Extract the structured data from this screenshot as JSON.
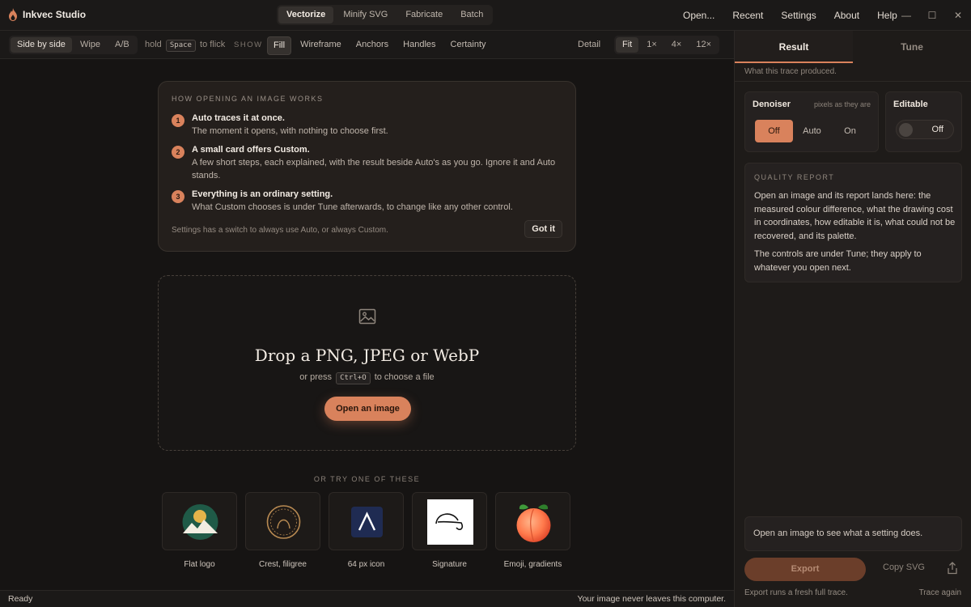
{
  "app": {
    "name": "Inkvec Studio"
  },
  "modes": [
    "Vectorize",
    "Minify SVG",
    "Fabricate",
    "Batch"
  ],
  "menu": [
    "Open...",
    "Recent",
    "Settings",
    "About",
    "Help"
  ],
  "window_controls": {
    "minimize": "—",
    "maximize": "☐",
    "close": "✕"
  },
  "toolbar": {
    "compare": [
      "Side by side",
      "Wipe",
      "A/B"
    ],
    "hold": "hold",
    "space_key": "Space",
    "to_flick": "to flick",
    "show_label": "SHOW",
    "show_items": [
      "Fill",
      "Wireframe",
      "Anchors",
      "Handles",
      "Certainty"
    ],
    "detail": "Detail",
    "zoom": [
      "Fit",
      "1×",
      "4×",
      "12×"
    ]
  },
  "how": {
    "title": "HOW OPENING AN IMAGE WORKS",
    "steps": [
      {
        "num": "1",
        "heading": "Auto traces it at once.",
        "desc": "The moment it opens, with nothing to choose first."
      },
      {
        "num": "2",
        "heading": "A small card offers Custom.",
        "desc": "A few short steps, each explained, with the result beside Auto's as you go. Ignore it and Auto stands."
      },
      {
        "num": "3",
        "heading": "Everything is an ordinary setting.",
        "desc": "What Custom chooses is under Tune afterwards, to change like any other control."
      }
    ],
    "footer": "Settings has a switch to always use Auto, or always Custom.",
    "got_it": "Got it"
  },
  "drop": {
    "title": "Drop a PNG, JPEG or WebP",
    "sub_before": "or press",
    "shortcut": "Ctrl+O",
    "sub_after": "to choose a file",
    "button": "Open an image"
  },
  "samples": {
    "label": "OR TRY ONE OF THESE",
    "items": [
      "Flat logo",
      "Crest, filigree",
      "64 px icon",
      "Signature",
      "Emoji, gradients"
    ]
  },
  "status": {
    "left": "Ready",
    "right": "Your image never leaves this computer."
  },
  "panel": {
    "tabs": [
      "Result",
      "Tune"
    ],
    "subtitle": "What this trace produced.",
    "denoiser": {
      "title": "Denoiser",
      "note": "pixels as they are",
      "options": [
        "Off",
        "Auto",
        "On"
      ],
      "selected": "Off"
    },
    "editable": {
      "title": "Editable",
      "state": "Off"
    },
    "quality": {
      "title": "QUALITY REPORT",
      "p1": "Open an image and its report lands here: the measured colour difference, what the drawing cost in coordinates, how editable it is, what could not be recovered, and its palette.",
      "p2": "The controls are under Tune; they apply to whatever you open next."
    },
    "hint": "Open an image to see what a setting does.",
    "export": "Export",
    "copy_svg": "Copy SVG",
    "foot_left": "Export runs a fresh full trace.",
    "foot_right": "Trace again"
  },
  "colors": {
    "accent": "#d9825c",
    "background": "#161413",
    "panel": "#1e1b19"
  }
}
